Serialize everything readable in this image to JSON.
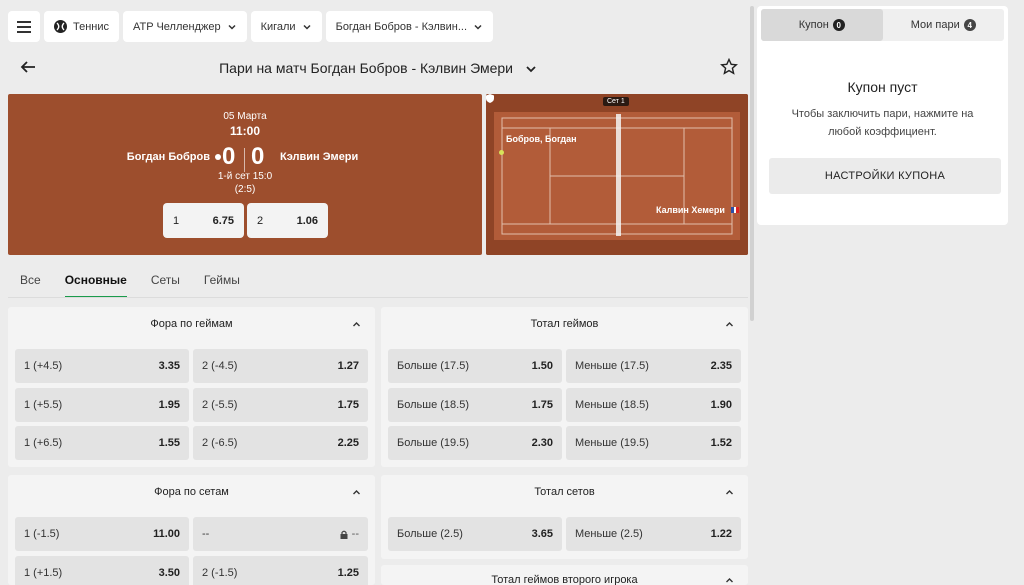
{
  "topbar": {
    "sport": "Теннис",
    "tournament": "ATP Челленджер",
    "city": "Кигали",
    "match": "Богдан Бобров - Кэлвин..."
  },
  "header": {
    "title": "Пари на матч Богдан Бобров - Кэлвин Эмери"
  },
  "scoreboard": {
    "date": "05 Марта",
    "time": "11:00",
    "player1": "Богдан Бобров",
    "player2": "Кэлвин Эмери",
    "score1": "0",
    "score2": "0",
    "set_info": "1-й сет 15:0",
    "game_info": "(2:5)",
    "odds": [
      {
        "label": "1",
        "value": "6.75"
      },
      {
        "label": "2",
        "value": "1.06"
      }
    ]
  },
  "court": {
    "set_label": "Сет 1",
    "player1": "Бобров, Богдан",
    "player2": "Калвин Хемери",
    "surface_color": "#8f4426"
  },
  "tabs": [
    {
      "label": "Все"
    },
    {
      "label": "Основные"
    },
    {
      "label": "Сеты"
    },
    {
      "label": "Геймы"
    }
  ],
  "markets": {
    "game_handicap": {
      "title": "Фора по геймам",
      "rows": [
        {
          "l": "1 (+4.5)",
          "lv": "3.35",
          "r": "2 (-4.5)",
          "rv": "1.27"
        },
        {
          "l": "1 (+5.5)",
          "lv": "1.95",
          "r": "2 (-5.5)",
          "rv": "1.75"
        },
        {
          "l": "1 (+6.5)",
          "lv": "1.55",
          "r": "2 (-6.5)",
          "rv": "2.25"
        }
      ]
    },
    "total_games": {
      "title": "Тотал геймов",
      "rows": [
        {
          "l": "Больше (17.5)",
          "lv": "1.50",
          "r": "Меньше (17.5)",
          "rv": "2.35"
        },
        {
          "l": "Больше (18.5)",
          "lv": "1.75",
          "r": "Меньше (18.5)",
          "rv": "1.90"
        },
        {
          "l": "Больше (19.5)",
          "lv": "2.30",
          "r": "Меньше (19.5)",
          "rv": "1.52"
        }
      ]
    },
    "set_handicap": {
      "title": "Фора по сетам",
      "rows": [
        {
          "l": "1 (-1.5)",
          "lv": "11.00",
          "r": "--",
          "rv": "--"
        },
        {
          "l": "1 (+1.5)",
          "lv": "3.50",
          "r": "2 (-1.5)",
          "rv": "1.25"
        }
      ]
    },
    "total_sets": {
      "title": "Тотал сетов",
      "rows": [
        {
          "l": "Больше (2.5)",
          "lv": "3.65",
          "r": "Меньше (2.5)",
          "rv": "1.22"
        }
      ]
    },
    "player2_total_games": {
      "title": "Тотал геймов второго игрока"
    }
  },
  "coupon": {
    "tab_coupon": "Купон",
    "tab_coupon_count": "0",
    "tab_bets": "Мои пари",
    "tab_bets_count": "4",
    "empty_title": "Купон пуст",
    "empty_hint": "Чтобы заключить пари, нажмите на любой коэффициент.",
    "settings_button": "НАСТРОЙКИ КУПОНА"
  },
  "colors": {
    "accent": "#1a9b4b",
    "scoreboard_bg": "#9d4e2d"
  }
}
